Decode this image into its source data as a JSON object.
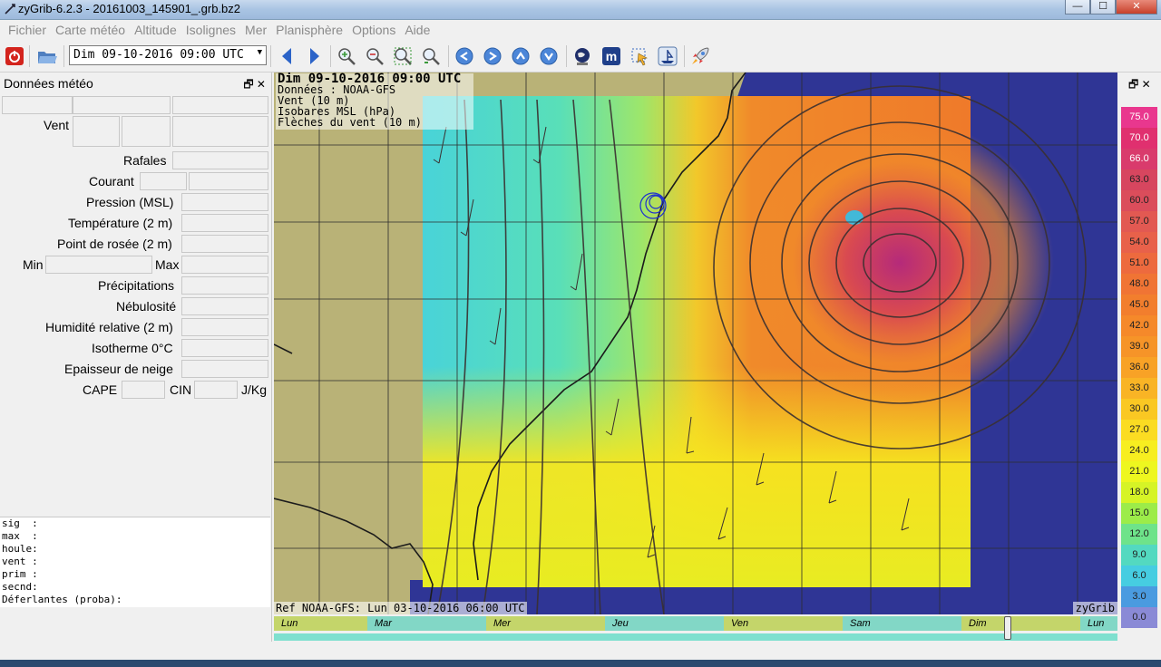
{
  "window": {
    "title": "zyGrib-6.2.3 - 20161003_145901_.grb.bz2",
    "min": "—",
    "max": "☐",
    "close": "✕"
  },
  "menu": [
    "Fichier",
    "Carte météo",
    "Altitude",
    "Isolignes",
    "Mer",
    "Planisphère",
    "Options",
    "Aide"
  ],
  "toolbar": {
    "date_value": "Dim 09-10-2016 09:00 UTC",
    "icons": [
      "quit-icon",
      "open-icon",
      "prev-icon",
      "next-icon",
      "zoom-in-icon",
      "zoom-out-icon",
      "zoom-fit-icon",
      "zoom-all-icon",
      "pan-left-icon",
      "pan-right-icon",
      "pan-up-icon",
      "pan-down-icon",
      "globe-icon",
      "meteotable-icon",
      "select-icon",
      "boat-icon",
      "rocket-icon"
    ]
  },
  "panel": {
    "title": "Données météo",
    "labels": {
      "vent": "Vent",
      "rafales": "Rafales",
      "courant": "Courant",
      "pression": "Pression (MSL)",
      "temperature": "Température (2 m)",
      "rosee": "Point de rosée (2 m)",
      "min": "Min",
      "max": "Max",
      "precip": "Précipitations",
      "nebulosite": "Nébulosité",
      "humidite": "Humidité relative (2 m)",
      "isotherme": "Isotherme 0°C",
      "neige": "Epaisseur de neige",
      "cape": "CAPE",
      "cin": "CIN",
      "jkg": "J/Kg"
    },
    "readout": [
      "sig  :",
      "max  :",
      "houle:",
      "vent :",
      "prim :",
      "secnd:",
      "Déferlantes (proba):"
    ]
  },
  "map": {
    "info_lines": [
      "Dim 09-10-2016 09:00 UTC",
      "Données : NOAA-GFS",
      "Vent (10 m)",
      "Isobares MSL (hPa)",
      "Flèches du vent (10 m)"
    ],
    "ref": "Ref NOAA-GFS: Lun 03-10-2016 06:00 UTC",
    "brand": "zyGrib"
  },
  "timeline": {
    "days": [
      "Lun",
      "Mar",
      "Mer",
      "Jeu",
      "Ven",
      "Sam",
      "Dim",
      "Lun"
    ],
    "current_fraction": 0.87
  },
  "legend": {
    "values": [
      "75.0",
      "70.0",
      "66.0",
      "63.0",
      "60.0",
      "57.0",
      "54.0",
      "51.0",
      "48.0",
      "45.0",
      "42.0",
      "39.0",
      "36.0",
      "33.0",
      "30.0",
      "27.0",
      "24.0",
      "21.0",
      "18.0",
      "15.0",
      "12.0",
      "9.0",
      "6.0",
      "3.0",
      "0.0"
    ],
    "colors": [
      "#e9378e",
      "#e0306f",
      "#d93b6c",
      "#d7465f",
      "#db4d5b",
      "#e25952",
      "#e8614a",
      "#ed6a3e",
      "#f07434",
      "#f27e2d",
      "#f5892a",
      "#f69428",
      "#f8a226",
      "#f9b425",
      "#fac823",
      "#fbdc22",
      "#f7ee20",
      "#eef71f",
      "#d6f426",
      "#9cec49",
      "#6ee38a",
      "#53d9c0",
      "#46cde1",
      "#4a9be0",
      "#8a8ad6"
    ]
  }
}
